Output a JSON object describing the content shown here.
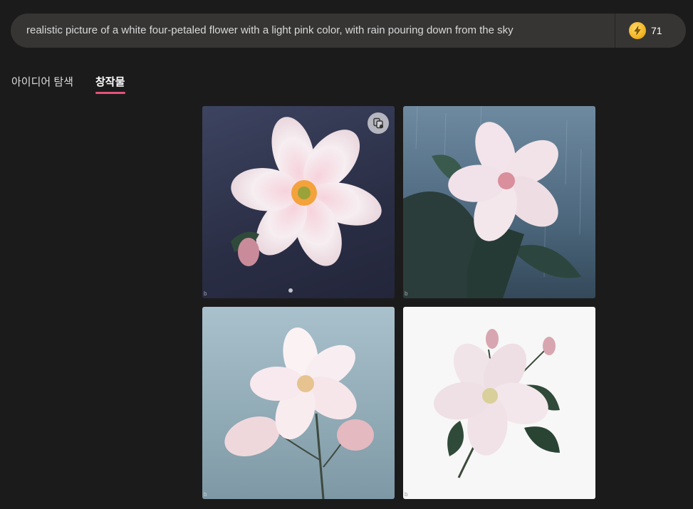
{
  "prompt": {
    "text": "realistic picture of a white four-petaled flower with a light pink color, with rain pouring down from the sky"
  },
  "boosts": {
    "icon": "lightning-coin-icon",
    "count": "71",
    "coin_color": "#f3b526"
  },
  "tabs": [
    {
      "label": "아이디어 탐색",
      "active": false
    },
    {
      "label": "창작물",
      "active": true
    }
  ],
  "accent_color": "#e4537a",
  "images": [
    {
      "subject": "pink-white flower with rain drops on dark navy background",
      "mark": "b"
    },
    {
      "subject": "pink-white flower on leafy branch in rain, blue-gray background",
      "mark": "b"
    },
    {
      "subject": "white-pink flower with buds on stems, pale blue-gray background",
      "mark": "b"
    },
    {
      "subject": "white-pink flower with buds and green leaves, white background",
      "mark": "b"
    }
  ],
  "copy_icon": "copy-icon"
}
